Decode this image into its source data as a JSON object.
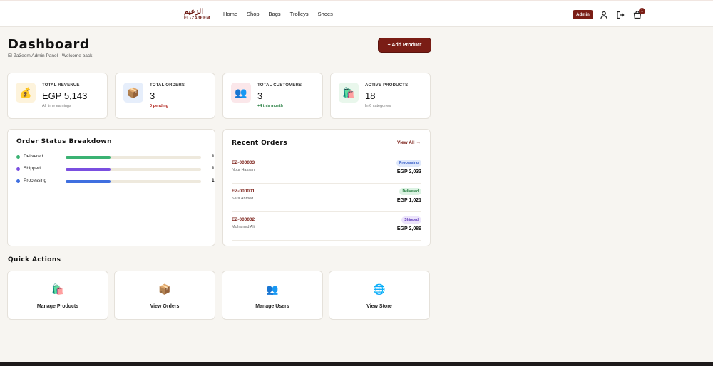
{
  "brand": {
    "logo_ar": "الزعيم",
    "logo_en": "EL-ZA3EEM"
  },
  "nav": {
    "items": [
      "Home",
      "Shop",
      "Bags",
      "Trolleys",
      "Shoes"
    ]
  },
  "header": {
    "admin_label": "Admin",
    "cart_count": "1"
  },
  "page": {
    "title": "Dashboard",
    "subtitle": "El-Za3eem Admin Panel · Welcome back",
    "add_product_label": "+ Add Product"
  },
  "stats": [
    {
      "label": "TOTAL REVENUE",
      "value": "EGP 5,143",
      "note": "All time earnings",
      "icon": "money-bag-icon",
      "glyph": "💰",
      "icon_bg": "#fdf3dc"
    },
    {
      "label": "TOTAL ORDERS",
      "value": "3",
      "note": "0 pending",
      "icon": "package-icon",
      "glyph": "📦",
      "icon_bg": "#e6eefb"
    },
    {
      "label": "TOTAL CUSTOMERS",
      "value": "3",
      "note": "+4 this month",
      "icon": "users-icon",
      "glyph": "👥",
      "icon_bg": "#fbe7ea"
    },
    {
      "label": "ACTIVE PRODUCTS",
      "value": "18",
      "note": "In 6 categories",
      "icon": "shopping-bags-icon",
      "glyph": "🛍️",
      "icon_bg": "#e9f7ec"
    }
  ],
  "status_breakdown": {
    "title": "Order Status Breakdown",
    "rows": [
      {
        "name": "Delivered",
        "count": "1",
        "fraction": 0.333,
        "color": "#3bb273"
      },
      {
        "name": "Shipped",
        "count": "1",
        "fraction": 0.333,
        "color": "#7a4fe0"
      },
      {
        "name": "Processing",
        "count": "1",
        "fraction": 0.333,
        "color": "#3f6fe0"
      }
    ]
  },
  "recent_orders": {
    "title": "Recent Orders",
    "view_all_label": "View All →",
    "orders": [
      {
        "id": "EZ-000003",
        "customer": "Nour Hassan",
        "status": "Processing",
        "amount": "EGP 2,033",
        "badge_bg": "#dfe8fb",
        "badge_fg": "#2d56c4"
      },
      {
        "id": "EZ-000001",
        "customer": "Sara Ahmed",
        "status": "Delivered",
        "amount": "EGP 1,021",
        "badge_bg": "#dcf3e3",
        "badge_fg": "#1f7a3a"
      },
      {
        "id": "EZ-000002",
        "customer": "Mohamed Ali",
        "status": "Shipped",
        "amount": "EGP 2,089",
        "badge_bg": "#ece4fb",
        "badge_fg": "#5a33b8"
      }
    ]
  },
  "quick_actions": {
    "title": "Quick Actions",
    "items": [
      {
        "label": "Manage Products",
        "icon": "shopping-bags-icon",
        "glyph": "🛍️"
      },
      {
        "label": "View Orders",
        "icon": "package-icon",
        "glyph": "📦"
      },
      {
        "label": "Manage Users",
        "icon": "users-icon",
        "glyph": "👥"
      },
      {
        "label": "View Store",
        "icon": "globe-icon",
        "glyph": "🌐"
      }
    ]
  },
  "colors": {
    "accent": "#7a1d15",
    "background": "#f7f5f1"
  }
}
